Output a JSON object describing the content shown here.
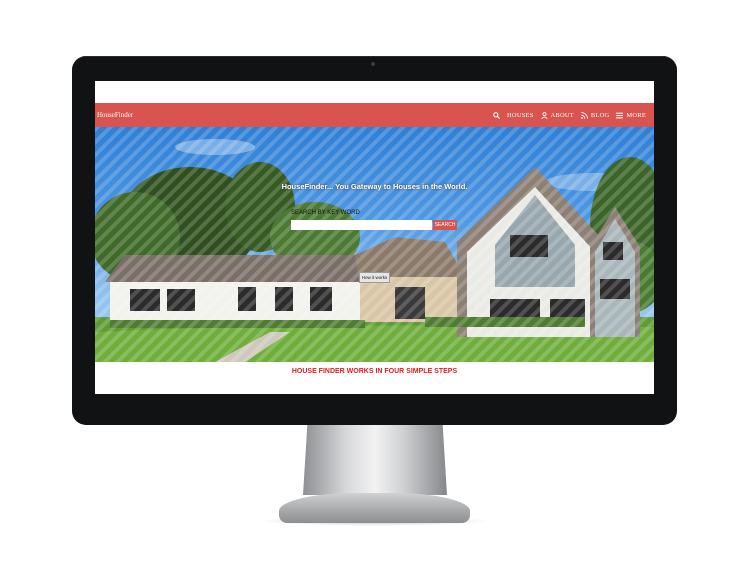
{
  "navbar": {
    "brand": "HouseFinder",
    "items": [
      {
        "label": "HOUSES",
        "icon": "search-icon"
      },
      {
        "label": "ABOUT",
        "icon": "user-icon"
      },
      {
        "label": "BLOG",
        "icon": "rss-icon"
      },
      {
        "label": "MORE",
        "icon": "menu-icon"
      }
    ]
  },
  "hero": {
    "tagline": "HouseFinder... You Gateway to Houses in the World.",
    "search_label": "SEARCH BY KEY WORD",
    "search_value": "",
    "search_button": "SEARCH",
    "how_button": "How it works"
  },
  "steps": {
    "heading": "HOUSE FINDER WORKS IN FOUR SIMPLE STEPS"
  },
  "colors": {
    "brand": "#d9534f",
    "steps_heading": "#e02020",
    "monitor_bezel": "#111214"
  }
}
